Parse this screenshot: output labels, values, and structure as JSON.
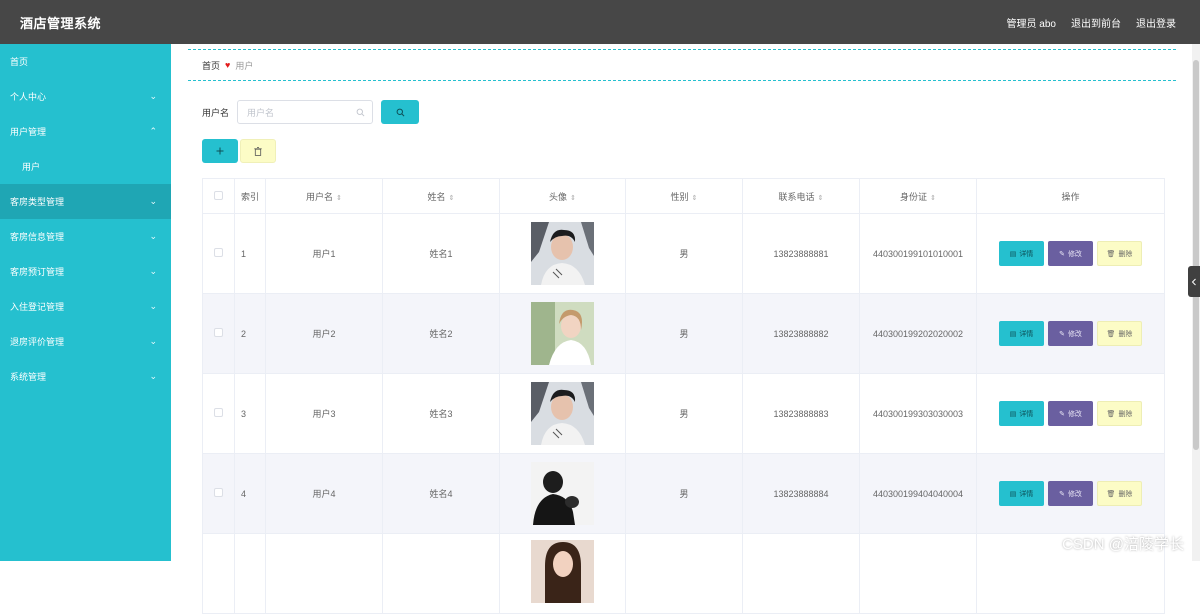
{
  "app": {
    "title": "酒店管理系统"
  },
  "header": {
    "admin_label": "管理员 abo",
    "front_link": "退出到前台",
    "logout_link": "退出登录"
  },
  "sidebar": {
    "items": [
      {
        "label": "首页",
        "chevron": ""
      },
      {
        "label": "个人中心",
        "chevron": "⌄"
      },
      {
        "label": "用户管理",
        "chevron": "⌃"
      },
      {
        "label": "用户",
        "chevron": ""
      },
      {
        "label": "客房类型管理",
        "chevron": "⌄"
      },
      {
        "label": "客房信息管理",
        "chevron": "⌄"
      },
      {
        "label": "客房预订管理",
        "chevron": "⌄"
      },
      {
        "label": "入住登记管理",
        "chevron": "⌄"
      },
      {
        "label": "退房评价管理",
        "chevron": "⌄"
      },
      {
        "label": "系统管理",
        "chevron": "⌄"
      }
    ]
  },
  "breadcrumb": {
    "home": "首页",
    "separator": "♥",
    "current": "用户"
  },
  "search": {
    "label": "用户名",
    "placeholder": "用户名"
  },
  "table": {
    "headers": [
      "索引",
      "用户名",
      "姓名",
      "头像",
      "性别",
      "联系电话",
      "身份证",
      "操作"
    ],
    "ops": {
      "detail": "详情",
      "edit": "修改",
      "delete": "删除"
    },
    "rows": [
      {
        "index": "1",
        "username": "用户1",
        "name": "姓名1",
        "gender": "男",
        "phone": "13823888881",
        "id_card": "440300199101010001"
      },
      {
        "index": "2",
        "username": "用户2",
        "name": "姓名2",
        "gender": "男",
        "phone": "13823888882",
        "id_card": "440300199202020002"
      },
      {
        "index": "3",
        "username": "用户3",
        "name": "姓名3",
        "gender": "男",
        "phone": "13823888883",
        "id_card": "440300199303030003"
      },
      {
        "index": "4",
        "username": "用户4",
        "name": "姓名4",
        "gender": "男",
        "phone": "13823888884",
        "id_card": "440300199404040004"
      }
    ]
  },
  "watermark": "CSDN @涪陵学长",
  "colors": {
    "accent": "#25c0cf",
    "topbar": "#474747",
    "edit": "#6a5fa0",
    "delete": "#fcfcc6"
  }
}
